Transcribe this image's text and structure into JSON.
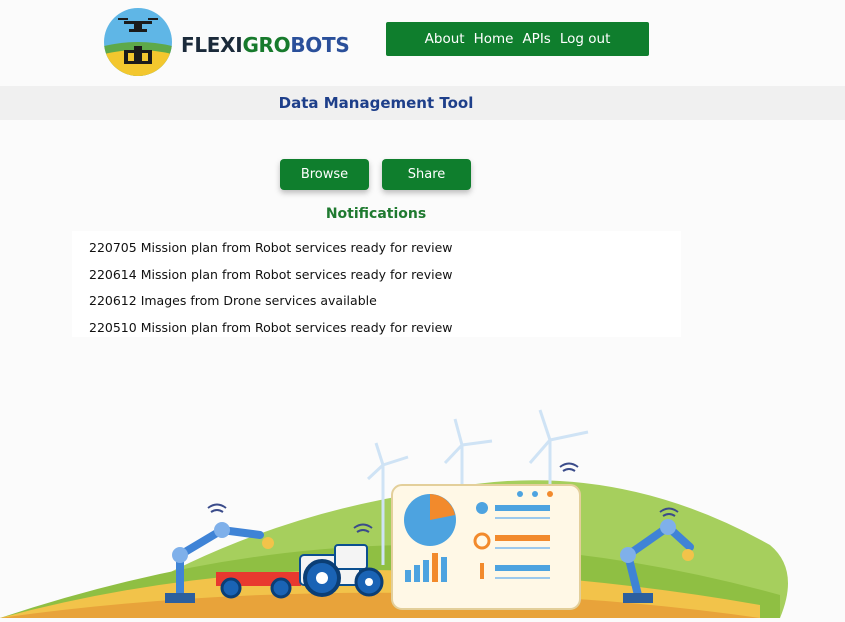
{
  "header": {
    "brand": {
      "part1": "FLEXI",
      "part2": "GRO",
      "part3": "BOTS"
    },
    "nav": {
      "about": "About",
      "home": "Home",
      "apis": "APIs",
      "logout": "Log out"
    }
  },
  "page": {
    "title": "Data Management Tool"
  },
  "actions": {
    "browse": "Browse",
    "share": "Share"
  },
  "notifications": {
    "title": "Notifications",
    "items": [
      "220705 Mission plan from Robot services ready for review",
      "220614 Mission plan from Robot services ready for review",
      "220612 Images from Drone services available",
      "220510 Mission plan from Robot services ready for review"
    ]
  },
  "colors": {
    "primary": "#0f7e2d",
    "title_blue": "#1e3f8a",
    "notif_green": "#1f7a30"
  },
  "icons": {
    "logo": "drone-tractor-logo-icon",
    "illustration": "smart-farm-illustration"
  }
}
